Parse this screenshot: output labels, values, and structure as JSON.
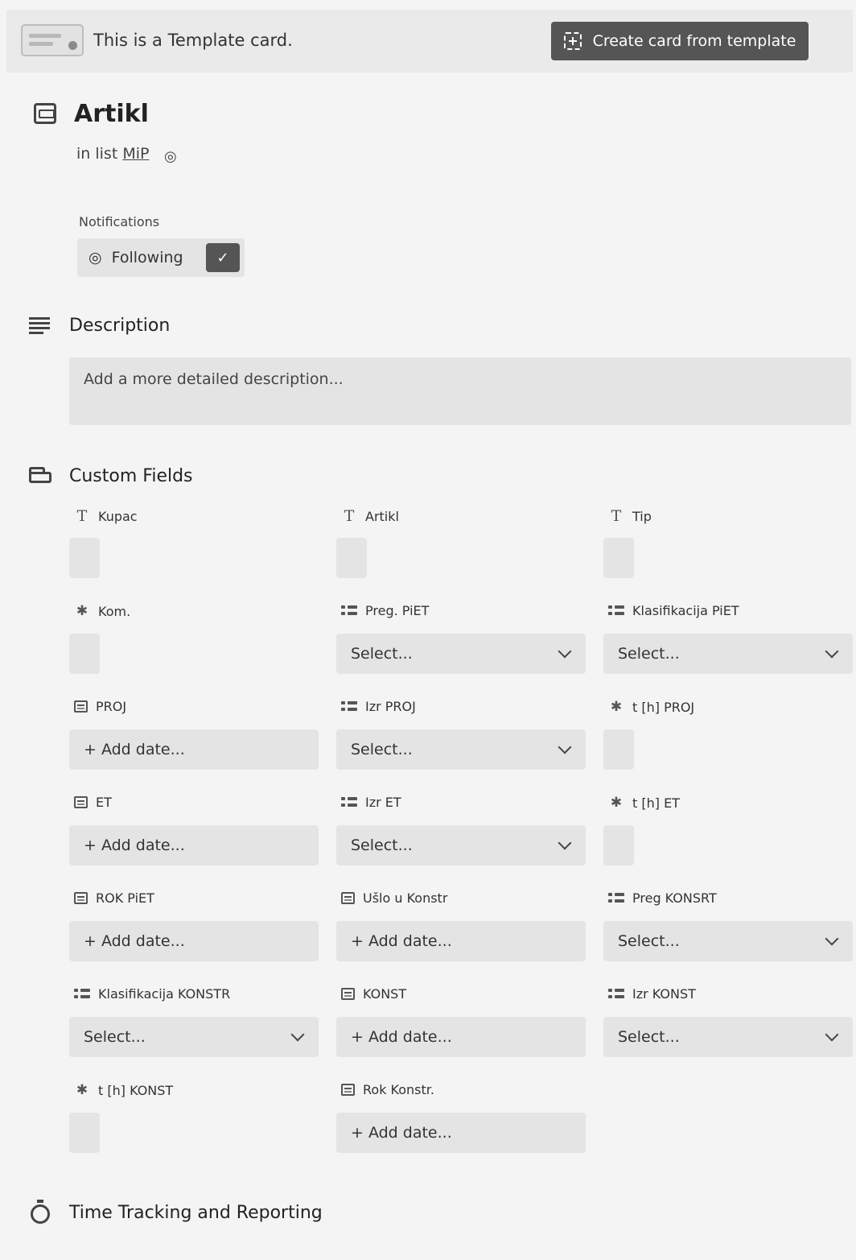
{
  "banner": {
    "text": "This is a Template card.",
    "create_button_label": "Create card from template"
  },
  "card": {
    "title": "Artikl",
    "in_list_prefix": "in list",
    "list_name": "MiP"
  },
  "notifications": {
    "label": "Notifications",
    "following_label": "Following",
    "following_checked": true
  },
  "description": {
    "title": "Description",
    "placeholder": "Add a more detailed description..."
  },
  "custom_fields": {
    "title": "Custom Fields",
    "fields": [
      {
        "label": "Kupac",
        "type": "text",
        "value": ""
      },
      {
        "label": "Artikl",
        "type": "text",
        "value": ""
      },
      {
        "label": "Tip",
        "type": "text",
        "value": ""
      },
      {
        "label": "Kom.",
        "type": "number",
        "value": ""
      },
      {
        "label": "Preg. PiET",
        "type": "select",
        "value": "Select..."
      },
      {
        "label": "Klasifikacija PiET",
        "type": "select",
        "value": "Select..."
      },
      {
        "label": "PROJ",
        "type": "date",
        "value": "+ Add date..."
      },
      {
        "label": "Izr PROJ",
        "type": "select",
        "value": "Select..."
      },
      {
        "label": "t [h] PROJ",
        "type": "number",
        "value": ""
      },
      {
        "label": "ET",
        "type": "date",
        "value": "+ Add date..."
      },
      {
        "label": "Izr ET",
        "type": "select",
        "value": "Select..."
      },
      {
        "label": "t [h] ET",
        "type": "number",
        "value": ""
      },
      {
        "label": "ROK PiET",
        "type": "date",
        "value": "+ Add date..."
      },
      {
        "label": "Ušlo u Konstr",
        "type": "date",
        "value": "+ Add date..."
      },
      {
        "label": "Preg KONSRT",
        "type": "select",
        "value": "Select..."
      },
      {
        "label": "Klasifikacija KONSTR",
        "type": "select",
        "value": "Select..."
      },
      {
        "label": "KONST",
        "type": "date",
        "value": "+ Add date..."
      },
      {
        "label": "Izr KONST",
        "type": "select",
        "value": "Select..."
      },
      {
        "label": "t [h] KONST",
        "type": "number",
        "value": ""
      },
      {
        "label": "Rok Konstr.",
        "type": "date",
        "value": "+ Add date..."
      }
    ]
  },
  "time_tracking": {
    "title": "Time Tracking and Reporting"
  },
  "icons": {
    "banner": "template-card-icon",
    "create": "add-template-icon",
    "card": "card-icon",
    "watch": "eye-icon",
    "check": "check-icon",
    "description": "description-lines-icon",
    "custom_fields": "custom-fields-icon",
    "time_tracking": "stopwatch-icon"
  }
}
